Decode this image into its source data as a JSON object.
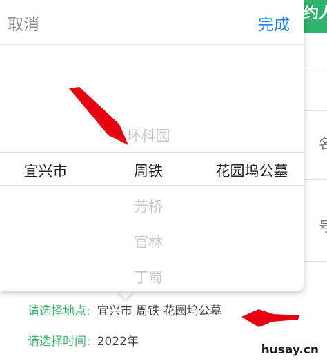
{
  "background": {
    "tag_text": "约人",
    "edge_chars": [
      "名",
      "号"
    ]
  },
  "form": {
    "location_label": "请选择地点:",
    "location_value": "宜兴市 周铁 花园坞公墓",
    "time_label": "请选择时间:",
    "time_value": "2022年"
  },
  "picker": {
    "cancel_label": "取消",
    "done_label": "完成",
    "column1": {
      "selected": "宜兴市"
    },
    "column2": {
      "above": [
        "环科园"
      ],
      "selected": "周铁",
      "below": [
        "芳桥",
        "官林",
        "丁蜀"
      ]
    },
    "column3": {
      "selected": "花园坞公墓"
    }
  },
  "colors": {
    "accent_blue": "#1e7ee6",
    "label_green": "#3cb371",
    "tag_green": "#2fb36a",
    "arrow_red": "#e60012"
  },
  "watermark": "husay.cn"
}
